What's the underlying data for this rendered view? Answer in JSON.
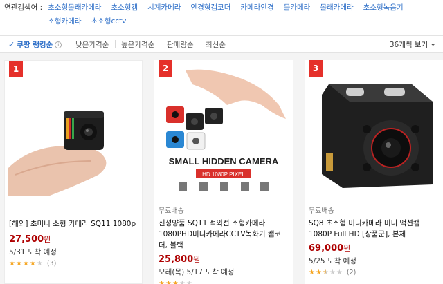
{
  "related": {
    "label": "연관검색어 :",
    "tags": [
      "초소형몰래카메라",
      "초소형캠",
      "시계카메라",
      "안경형캠코더",
      "카메라안경",
      "몰카메라",
      "몰래카메라",
      "초소형녹음기",
      "소형카메라",
      "초소형cctv"
    ]
  },
  "sort": {
    "active": "쿠팡 랭킹순",
    "options": [
      "낮은가격순",
      "높은가격순",
      "판매량순",
      "최신순"
    ],
    "view": "36개씩 보기"
  },
  "colors": {
    "link": "#2e6fc8",
    "price": "#ae0000",
    "rank": "#e5302a",
    "star": "#f5a623"
  },
  "products": [
    {
      "rank": "1",
      "free_shipping": "",
      "title": "[해외] 초미니 소형 카메라 SQ11 1080p",
      "price": "27,500",
      "currency": "원",
      "delivery": "5/31 도착 예정",
      "rating": 4,
      "reviews": "(3)"
    },
    {
      "rank": "2",
      "free_shipping": "무료배송",
      "title": "진성양품 SQ11 적외선 소형카메라 1080PHD미니카메라CCTV녹화기 캠코더, 블랙",
      "price": "25,800",
      "currency": "원",
      "delivery": "모레(목) 5/17 도착 예정",
      "rating": 3,
      "reviews": ""
    },
    {
      "rank": "3",
      "free_shipping": "무료배송",
      "title": "SQ8 초소형 미니카메라 미니 액션캠 1080P Full HD [상품군], 본체",
      "price": "69,000",
      "currency": "원",
      "delivery": "5/25 도착 예정",
      "rating": 2.5,
      "reviews": "(2)"
    }
  ],
  "image2_text": {
    "banner": "SMALL HIDDEN CAMERA",
    "sub": "HD 1080P PIXEL"
  }
}
